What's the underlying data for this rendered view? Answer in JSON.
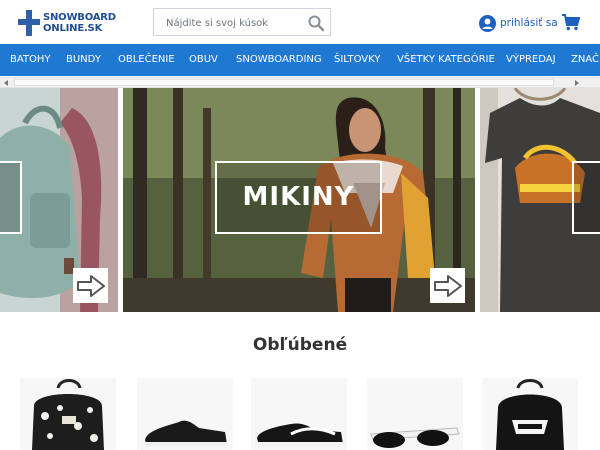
{
  "header": {
    "logo": {
      "line1": "SNOWBOARD",
      "line2": "ONLINE.SK"
    },
    "search": {
      "placeholder": "Nájdite si svoj kúsok"
    },
    "login_label": "prihlásiť sa"
  },
  "nav": {
    "items": [
      {
        "label": "BATOHY"
      },
      {
        "label": "BUNDY"
      },
      {
        "label": "OBLEČENIE"
      },
      {
        "label": "OBUV"
      },
      {
        "label": "SNOWBOARDING"
      },
      {
        "label": "ŠILTOVKY"
      },
      {
        "label": "VŠETKY KATEGÓRIE"
      },
      {
        "label": "VÝPREDAJ"
      },
      {
        "label": "ZNAČ"
      }
    ]
  },
  "carousel": {
    "center_label": "MIKINY"
  },
  "section": {
    "title": "Obľúbené"
  },
  "colors": {
    "nav_bg": "#1f79d3",
    "logo_blue": "#2f5fa8",
    "link_blue": "#1f5fbf"
  },
  "icons": [
    "search-icon",
    "user-icon",
    "cart-icon",
    "arrow-right-icon",
    "scroll-left-icon",
    "scroll-right-icon"
  ]
}
